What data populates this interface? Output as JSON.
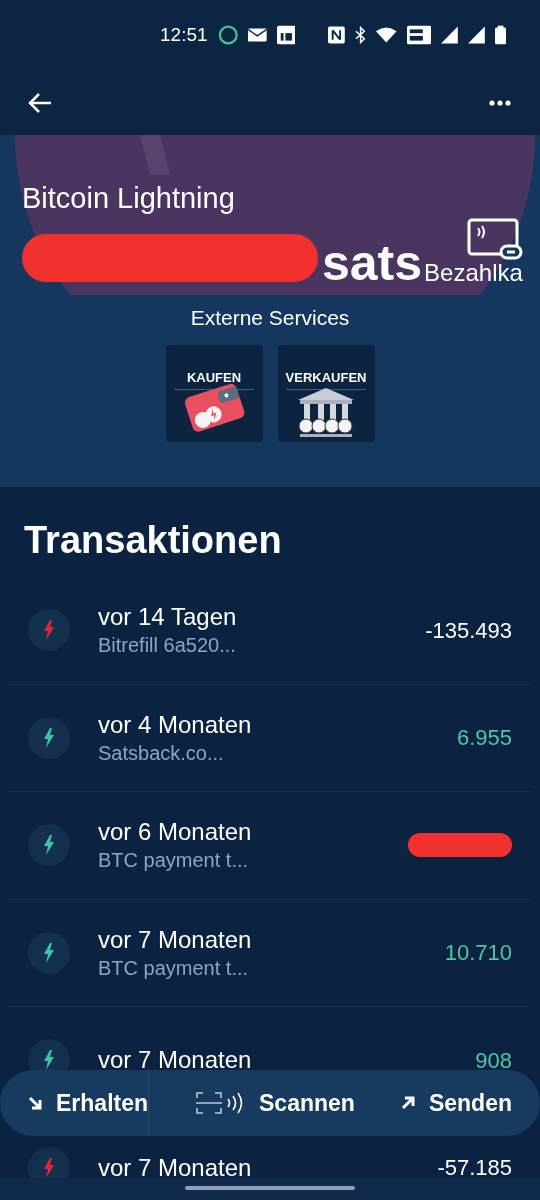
{
  "status_bar": {
    "time": "12:51"
  },
  "wallet": {
    "name": "Bitcoin Lightning",
    "balance_redacted": true,
    "unit": "sats",
    "pay_label": "Bezahlka"
  },
  "services": {
    "title": "Externe Services",
    "tiles": [
      {
        "kind": "buy",
        "label": "KAUFEN"
      },
      {
        "kind": "sell",
        "label": "VERKAUFEN"
      }
    ]
  },
  "transactions": {
    "title": "Transaktionen",
    "rows": [
      {
        "kind": "outgoing",
        "time": "vor 14 Tagen",
        "description": "Bitrefill 6a520...",
        "amount": "-135.493"
      },
      {
        "kind": "incoming",
        "time": "vor 4 Monaten",
        "description": "Satsback.co...",
        "amount": "6.955"
      },
      {
        "kind": "incoming",
        "time": "vor 6 Monaten",
        "description": "BTC payment t...",
        "amount_redacted": true
      },
      {
        "kind": "incoming",
        "time": "vor 7 Monaten",
        "description": "BTC payment t...",
        "amount": "10.710"
      },
      {
        "kind": "incoming",
        "time": "vor 7 Monaten",
        "amount": "908"
      },
      {
        "kind": "outgoing",
        "time": "vor 7 Monaten",
        "amount": "-57.185"
      }
    ]
  },
  "actions": [
    {
      "kind": "receive",
      "label": "Erhalten"
    },
    {
      "kind": "scan",
      "label": "Scannen"
    },
    {
      "kind": "send",
      "label": "Senden"
    }
  ]
}
